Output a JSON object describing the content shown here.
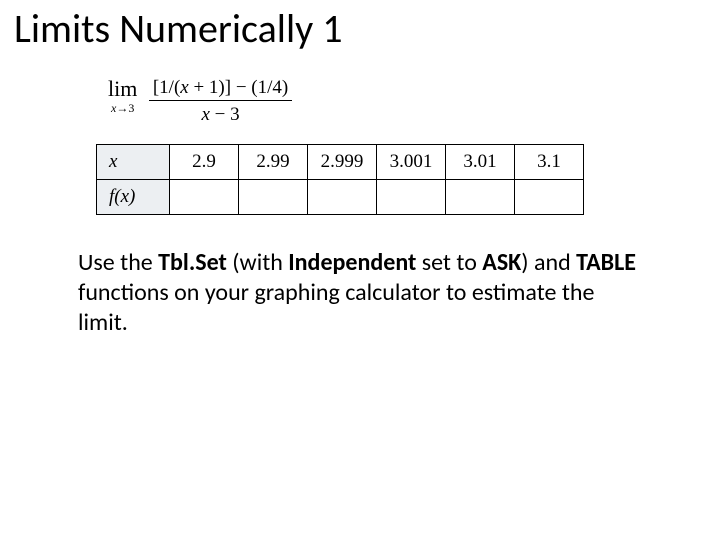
{
  "title": "Limits Numerically 1",
  "limit": {
    "lim_label": "lim",
    "xto": "x→3",
    "numerator": "[1/(x + 1)] − (1/4)",
    "denominator": "x − 3"
  },
  "table": {
    "row_x_label": "x",
    "row_fx_label": "f(x)",
    "cols": [
      "2.9",
      "2.99",
      "2.999",
      "3.001",
      "3.01",
      "3.1"
    ]
  },
  "instruction": {
    "p1": "Use the ",
    "b1": "Tbl.Set",
    "p2": " (with ",
    "b2": "Independent",
    "p3": " set to ",
    "b3": "ASK",
    "p4": ") and ",
    "b4": "TABLE",
    "p5": " functions on your graphing calculator to estimate the limit."
  }
}
